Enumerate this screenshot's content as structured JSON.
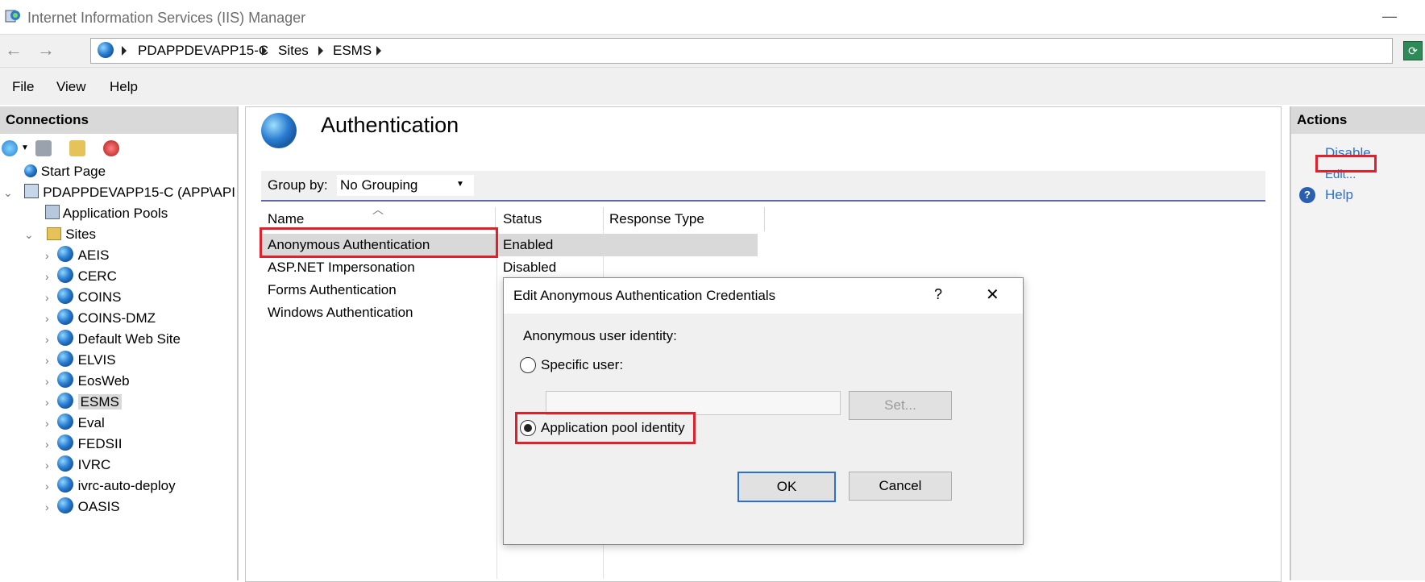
{
  "window": {
    "title": "Internet Information Services (IIS) Manager",
    "minimize_glyph": "—"
  },
  "address": {
    "back_glyph": "←",
    "forward_glyph": "→",
    "breadcrumb": [
      "PDAPPDEVAPP15-C",
      "Sites",
      "ESMS"
    ],
    "refresh_glyph": "⟳"
  },
  "menu": {
    "file": "File",
    "view": "View",
    "help": "Help"
  },
  "connections": {
    "header": "Connections",
    "tree": [
      {
        "label": "Start Page",
        "icon": "start-page-icon"
      },
      {
        "label": "PDAPPDEVAPP15-C (APP\\API",
        "icon": "server-icon"
      },
      {
        "label": "Application Pools",
        "icon": "app-pools-icon"
      },
      {
        "label": "Sites",
        "icon": "sites-folder-icon"
      },
      {
        "label": "AEIS"
      },
      {
        "label": "CERC"
      },
      {
        "label": "COINS"
      },
      {
        "label": "COINS-DMZ"
      },
      {
        "label": "Default Web Site"
      },
      {
        "label": "ELVIS"
      },
      {
        "label": "EosWeb"
      },
      {
        "label": "ESMS"
      },
      {
        "label": "Eval"
      },
      {
        "label": "FEDSII"
      },
      {
        "label": "IVRC"
      },
      {
        "label": "ivrc-auto-deploy"
      },
      {
        "label": "OASIS"
      }
    ]
  },
  "feature": {
    "title": "Authentication",
    "group_by_label": "Group by:",
    "group_by_value": "No Grouping",
    "columns": {
      "name": "Name",
      "status": "Status",
      "response_type": "Response Type"
    },
    "rows": [
      {
        "name": "Anonymous Authentication",
        "status": "Enabled",
        "response_type": ""
      },
      {
        "name": "ASP.NET Impersonation",
        "status": "Disabled",
        "response_type": ""
      },
      {
        "name": "Forms Authentication",
        "status": "",
        "response_type": ""
      },
      {
        "name": "Windows Authentication",
        "status": "",
        "response_type": ""
      }
    ]
  },
  "actions": {
    "header": "Actions",
    "disable": "Disable",
    "edit": "Edit...",
    "help": "Help"
  },
  "dialog": {
    "title": "Edit Anonymous Authentication Credentials",
    "help_glyph": "?",
    "close_glyph": "✕",
    "identity_label": "Anonymous user identity:",
    "specific_user_label": "Specific user:",
    "specific_user_value": "",
    "set_button": "Set...",
    "app_pool_identity_label": "Application pool identity",
    "selected_option": "Application pool identity",
    "ok": "OK",
    "cancel": "Cancel"
  },
  "colors": {
    "highlight_red": "#e0202a",
    "link_blue": "#2a6fd6",
    "selection_gray": "#d9d9d9"
  }
}
